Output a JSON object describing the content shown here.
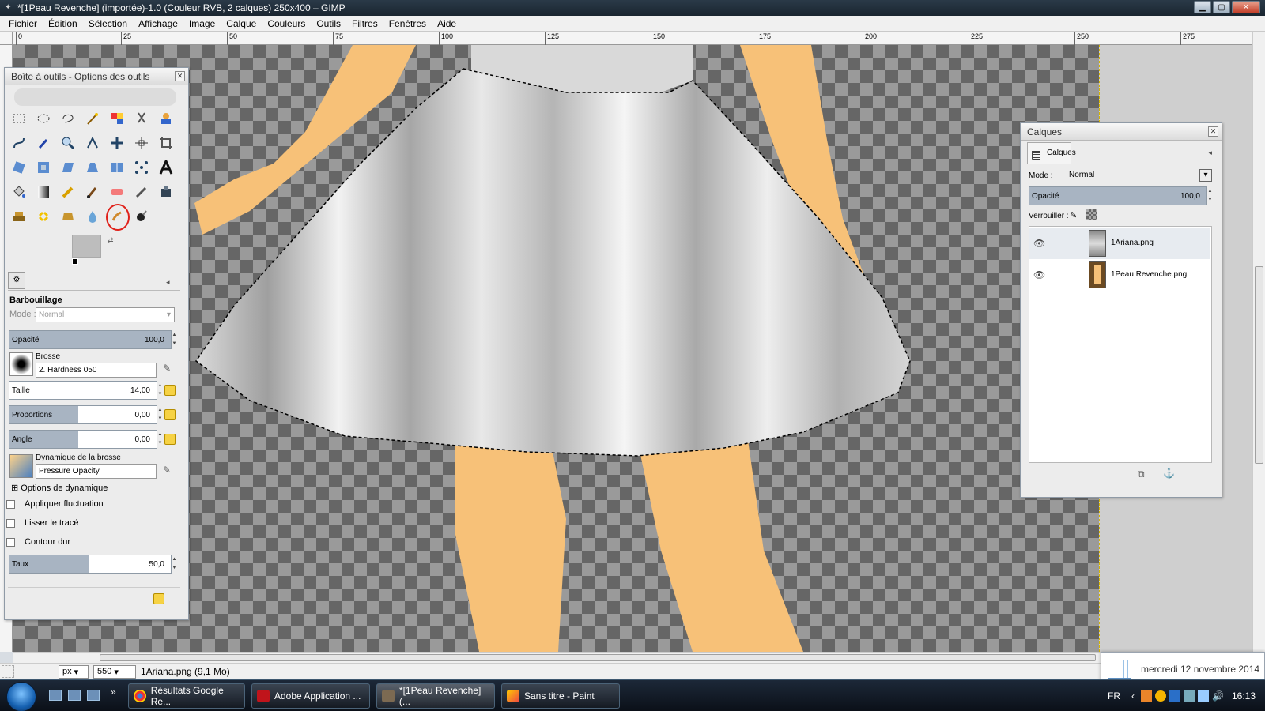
{
  "window": {
    "title": "*[1Peau Revenche] (importée)-1.0 (Couleur RVB, 2 calques) 250x400 – GIMP"
  },
  "menu": [
    "Fichier",
    "Édition",
    "Sélection",
    "Affichage",
    "Image",
    "Calque",
    "Couleurs",
    "Outils",
    "Filtres",
    "Fenêtres",
    "Aide"
  ],
  "ruler": {
    "ticks": [
      "0",
      "25",
      "50",
      "75",
      "100",
      "125",
      "150",
      "175",
      "200",
      "225",
      "250",
      "275"
    ]
  },
  "toolbox": {
    "title": "Boîte à outils - Options des outils",
    "tool_options": {
      "tool_name": "Barbouillage",
      "mode_label": "Mode :",
      "mode_value": "Normal",
      "opacity_label": "Opacité",
      "opacity_value": "100,0",
      "brush_label": "Brosse",
      "brush_value": "2. Hardness 050",
      "size_label": "Taille",
      "size_value": "14,00",
      "ratio_label": "Proportions",
      "ratio_value": "0,00",
      "angle_label": "Angle",
      "angle_value": "0,00",
      "dynamics_label": "Dynamique de la brosse",
      "dynamics_value": "Pressure Opacity",
      "dynamics_options": "Options de dynamique",
      "apply_jitter": "Appliquer fluctuation",
      "smooth_stroke": "Lisser le tracé",
      "hard_edge": "Contour dur",
      "rate_label": "Taux",
      "rate_value": "50,0"
    }
  },
  "layers": {
    "title": "Calques",
    "tab": "Calques",
    "mode_label": "Mode :",
    "mode_value": "Normal",
    "opacity_label": "Opacité",
    "opacity_value": "100,0",
    "lock_label": "Verrouiller :",
    "items": [
      {
        "name": "1Ariana.png"
      },
      {
        "name": "1Peau Revenche.png"
      }
    ]
  },
  "status": {
    "unit": "px",
    "zoom": "550",
    "message": "1Ariana.png (9,1 Mo)"
  },
  "date_popup": "mercredi 12 novembre 2014",
  "taskbar": {
    "tasks": [
      "Résultats Google Re...",
      "Adobe Application ...",
      "*[1Peau Revenche] (...",
      "Sans titre - Paint"
    ],
    "lang": "FR",
    "time": "16:13"
  },
  "colors": {
    "skin": "#f7c178",
    "skirt": "#c9c9c9",
    "selection": "#000000"
  }
}
